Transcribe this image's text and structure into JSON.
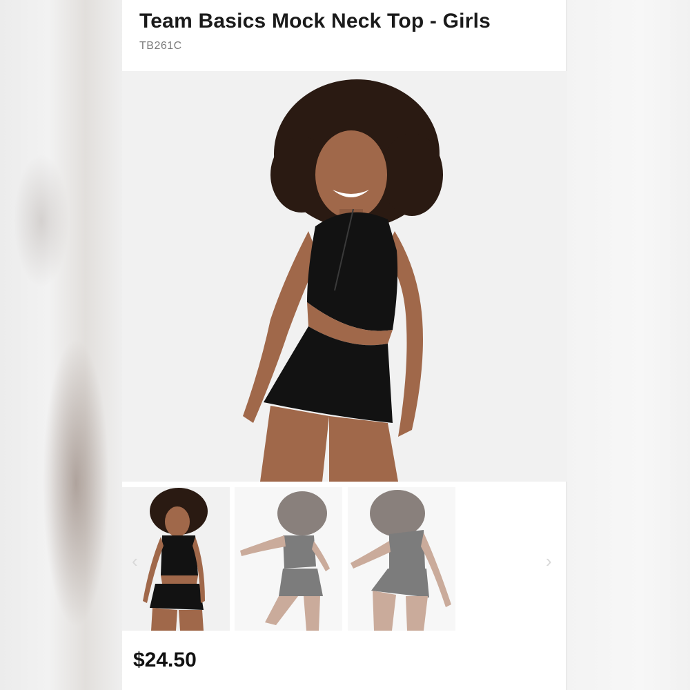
{
  "product": {
    "title": "Team Basics Mock Neck Top - Girls",
    "sku": "TB261C",
    "price": "$24.50"
  },
  "gallery": {
    "images": [
      {
        "name": "front-view"
      },
      {
        "name": "side-dance-view"
      },
      {
        "name": "back-view"
      }
    ],
    "prev_arrow": "‹",
    "next_arrow": "›"
  },
  "colors": {
    "garment": "#121212",
    "skin": "#a0684a",
    "hair": "#2a1a12",
    "background": "#f1f1f1"
  }
}
